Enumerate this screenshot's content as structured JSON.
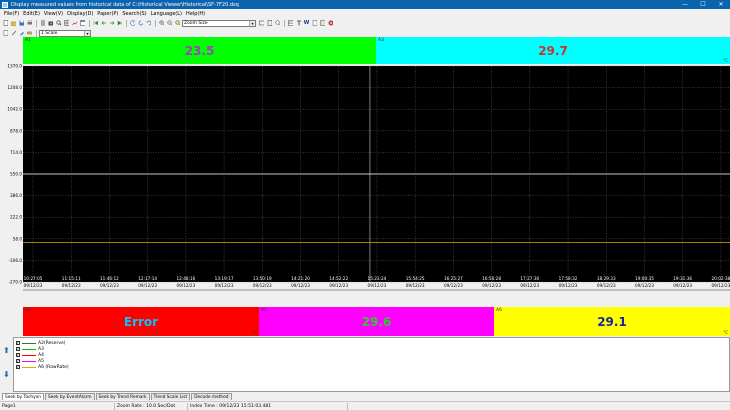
{
  "window": {
    "title": "Display measured values from historical data of C:\\Historical Viewer\\Historical\\SF-7F20.dsq",
    "minimize": "—",
    "maximize": "☐",
    "close": "✕"
  },
  "menu": [
    "File(F)",
    "Edit(E)",
    "View(V)",
    "Display(D)",
    "Paper(P)",
    "Search(S)",
    "Language(L)",
    "Help(H)"
  ],
  "toolbar": {
    "zoom_combo": "Zoom Size",
    "scale_combo": "1 Scale"
  },
  "top_tiles": [
    {
      "tag": "A1",
      "value": "23.5",
      "unit": "",
      "bg": "#00ff00",
      "fg": "#a040c0"
    },
    {
      "tag": "A3",
      "value": "29.7",
      "unit": "°C",
      "bg": "#00ffff",
      "fg": "#c83232"
    }
  ],
  "bottom_tiles": [
    {
      "tag": "A4",
      "value": "Error",
      "unit": "°C",
      "bg": "#ff0000",
      "fg": "#00c8ff"
    },
    {
      "tag": "A5",
      "value": "29.6",
      "unit": "",
      "bg": "#ff00ff",
      "fg": "#32c832"
    },
    {
      "tag": "A6",
      "value": "29.1",
      "unit": "°C",
      "bg": "#ffff00",
      "fg": "#1428a0"
    }
  ],
  "chart_data": {
    "type": "line",
    "y_ticks": [
      "1370.0",
      "1208.0",
      "1042.0",
      "878.0",
      "714.0",
      "550.0",
      "386.0",
      "222.0",
      "58.0",
      "-106.0",
      "-270.0"
    ],
    "ylim": [
      -270,
      1370
    ],
    "x_ticks": [
      {
        "time": "10:27:05",
        "date": "09/12/23"
      },
      {
        "time": "11:15:11",
        "date": "09/12/23"
      },
      {
        "time": "11:46:12",
        "date": "09/12/23"
      },
      {
        "time": "12:17:14",
        "date": "09/12/23"
      },
      {
        "time": "12:48:16",
        "date": "09/12/23"
      },
      {
        "time": "13:19:17",
        "date": "09/12/23"
      },
      {
        "time": "13:50:19",
        "date": "09/12/23"
      },
      {
        "time": "14:21:20",
        "date": "09/12/23"
      },
      {
        "time": "14:52:22",
        "date": "09/12/23"
      },
      {
        "time": "15:23:24",
        "date": "09/12/23"
      },
      {
        "time": "15:54:25",
        "date": "09/12/23"
      },
      {
        "time": "16:25:27",
        "date": "09/12/23"
      },
      {
        "time": "16:56:28",
        "date": "09/12/23"
      },
      {
        "time": "17:27:30",
        "date": "09/12/23"
      },
      {
        "time": "17:58:32",
        "date": "09/12/23"
      },
      {
        "time": "18:29:33",
        "date": "09/12/23"
      },
      {
        "time": "19:00:35",
        "date": "09/12/23"
      },
      {
        "time": "19:31:36",
        "date": "09/12/23"
      },
      {
        "time": "20:02:38",
        "date": "09/12/23"
      }
    ],
    "grid": true,
    "series": [
      {
        "name": "A1",
        "color": "#ffffff",
        "values": [
          550,
          550
        ]
      },
      {
        "name": "A2",
        "color": "#00c000",
        "values": [
          29.5,
          29.5
        ]
      },
      {
        "name": "A3",
        "color": "#ff8c00",
        "values": [
          29.3,
          29.3
        ]
      }
    ]
  },
  "legend": [
    {
      "label": "A2(Reserve)",
      "color": "#2a7a2a"
    },
    {
      "label": "A3",
      "color": "#00c000"
    },
    {
      "label": "A4",
      "color": "#ff0000"
    },
    {
      "label": "A5",
      "color": "#ff00ff"
    },
    {
      "label": "A6 (RawRate)",
      "color": "#d0b000"
    }
  ],
  "tabs": [
    "Seek by Tachyon",
    "Seek by EventAlarm",
    "Seek by Trend Remark",
    "Trend Scale List",
    "Decode method"
  ],
  "status": {
    "page": "Page1",
    "zoom": "Zoom Rate : 10.0 Sec/Dot",
    "index_time": "Index Time : 09/12/23 15:51:03.481"
  }
}
